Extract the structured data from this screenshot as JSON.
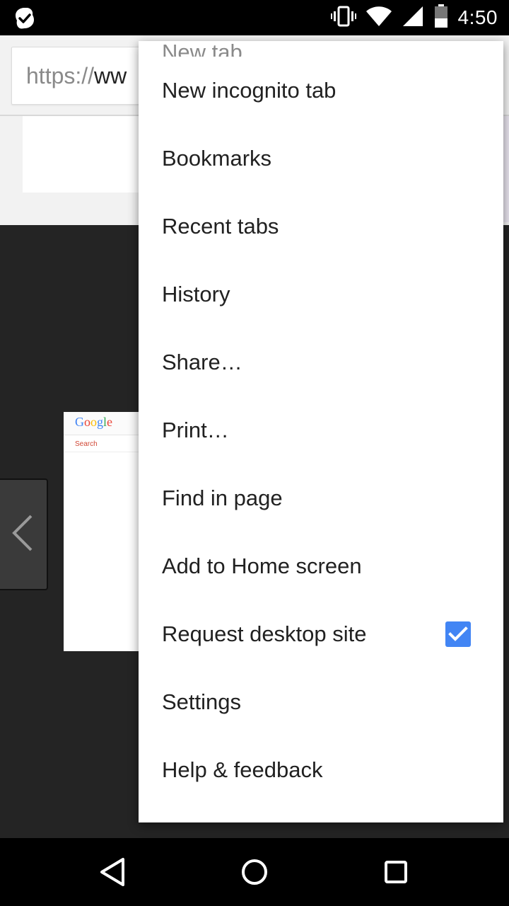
{
  "status_bar": {
    "time": "4:50",
    "icons": [
      "checkmark-app-icon",
      "vibrate-icon",
      "wifi-icon",
      "signal-icon",
      "battery-icon"
    ]
  },
  "browser": {
    "url_scheme": "https://",
    "url_rest": "ww"
  },
  "thumbnail": {
    "logo": "Google",
    "search_label": "Search",
    "logo_colors": [
      "#4285f4",
      "#ea4335",
      "#fbbc05",
      "#4285f4",
      "#34a853",
      "#ea4335"
    ]
  },
  "menu": {
    "items": [
      {
        "label": "New tab"
      },
      {
        "label": "New incognito tab"
      },
      {
        "label": "Bookmarks"
      },
      {
        "label": "Recent tabs"
      },
      {
        "label": "History"
      },
      {
        "label": "Share…"
      },
      {
        "label": "Print…"
      },
      {
        "label": "Find in page"
      },
      {
        "label": "Add to Home screen"
      },
      {
        "label": "Request desktop site",
        "checked": true
      },
      {
        "label": "Settings"
      },
      {
        "label": "Help & feedback"
      }
    ]
  },
  "colors": {
    "accent": "#4285f4",
    "menu_bg": "#ffffff",
    "tab_area_bg": "#242424"
  }
}
